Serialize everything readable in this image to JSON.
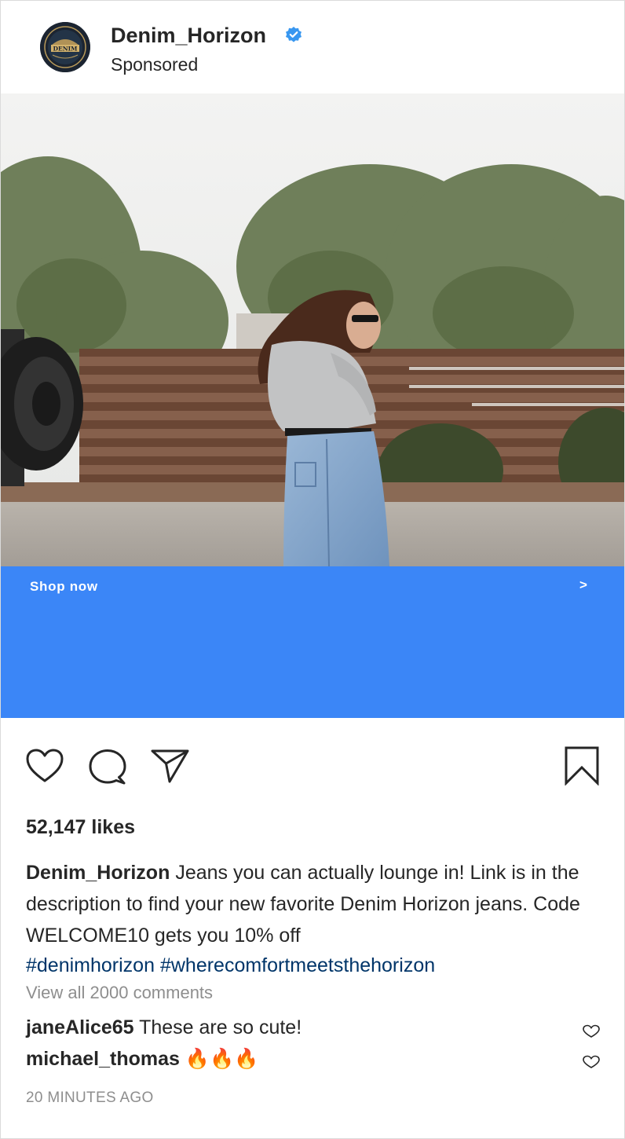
{
  "post": {
    "username": "Denim_Horizon",
    "subtitle": "Sponsored",
    "avatar_text": "DENIM",
    "icons": {
      "verified": "verified-badge-icon",
      "like": "heart-icon",
      "comment": "comment-bubble-icon",
      "share": "paper-plane-icon",
      "save": "bookmark-icon"
    },
    "colors": {
      "cta_background": "#3b86f7",
      "verified": "#3897f0",
      "hashtag": "#003569",
      "muted": "#8e8e8e"
    }
  },
  "cta": {
    "label": "Shop now",
    "arrow": ">"
  },
  "engagement": {
    "likes": "52,147 likes"
  },
  "caption": {
    "username": "Denim_Horizon",
    "text": "Jeans you can actually lounge in! Link is in the description to find your new favorite Denim Horizon jeans. Code WELCOME10 gets you 10% off",
    "hashtags": [
      "#denimhorizon",
      "#wherecomfortmeetsthehorizon"
    ]
  },
  "comments": {
    "view_all": "View all 2000 comments",
    "items": [
      {
        "username": "janeAlice65",
        "text": "These are so cute!"
      },
      {
        "username": "michael_thomas",
        "text": "🔥🔥🔥"
      }
    ]
  },
  "timestamp": "20 MINUTES AGO"
}
